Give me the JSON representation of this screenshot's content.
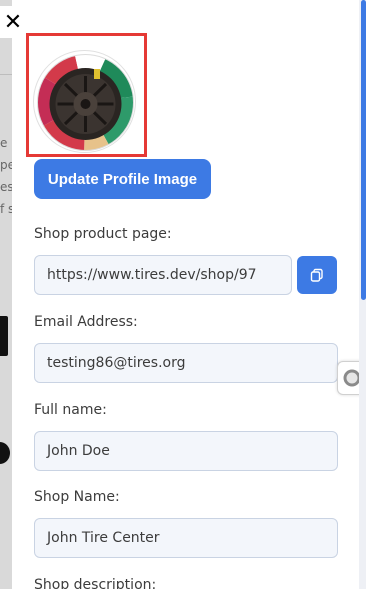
{
  "close": {
    "icon": "close-icon",
    "glyph": "✕"
  },
  "background": {
    "fragments": [
      "e r",
      "pe",
      "es",
      "f s"
    ]
  },
  "profile": {
    "avatar_icon": "tire-wheel-image",
    "update_button_label": "Update Profile Image"
  },
  "form": {
    "shop_product_page": {
      "label": "Shop product page:",
      "value": "https://www.tires.dev/shop/97"
    },
    "email": {
      "label": "Email Address:",
      "value": "testing86@tires.org"
    },
    "full_name": {
      "label": "Full name:",
      "value": "John Doe"
    },
    "shop_name": {
      "label": "Shop Name:",
      "value": "John Tire Center"
    },
    "shop_description": {
      "label": "Shop description:"
    }
  },
  "copy_button": {
    "icon": "copy-icon"
  },
  "floating_button": {
    "icon": "toggle-icon"
  },
  "colors": {
    "accent": "#3d7ae4",
    "highlight_border": "#e53935",
    "field_bg": "#f3f6fb",
    "field_border": "#c9d3e3"
  }
}
